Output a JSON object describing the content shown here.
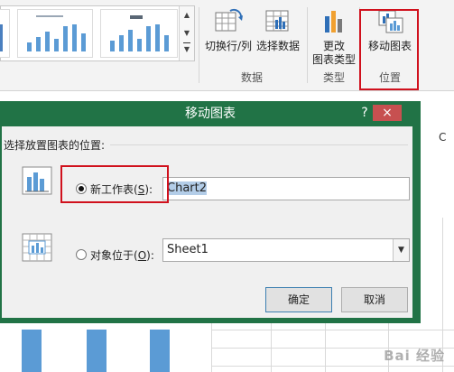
{
  "ribbon": {
    "switch_row_col_label": "切换行/列",
    "select_data_label": "选择数据",
    "data_group_label": "数据",
    "change_chart_type_line1": "更改",
    "change_chart_type_line2": "图表类型",
    "type_group_label": "类型",
    "move_chart_label": "移动图表",
    "location_group_label": "位置"
  },
  "sheet": {
    "column_header_c": "C"
  },
  "dialog": {
    "title": "移动图表",
    "help_label": "?",
    "close_label": "×",
    "prompt": "选择放置图表的位置:",
    "new_sheet": {
      "label_prefix": "新工作表(",
      "accelerator": "S",
      "label_suffix": "):",
      "value": "Chart2",
      "selected": true
    },
    "object_in": {
      "label_prefix": "对象位于(",
      "accelerator": "O",
      "label_suffix": "):",
      "value": "Sheet1",
      "selected": false
    },
    "ok_label": "确定",
    "cancel_label": "取消"
  },
  "watermark": "Bai 经验",
  "colors": {
    "dialog_frame": "#217346",
    "close_button": "#c75050",
    "highlight_box": "#d0111d",
    "chart_bar": "#5b9bd5"
  }
}
